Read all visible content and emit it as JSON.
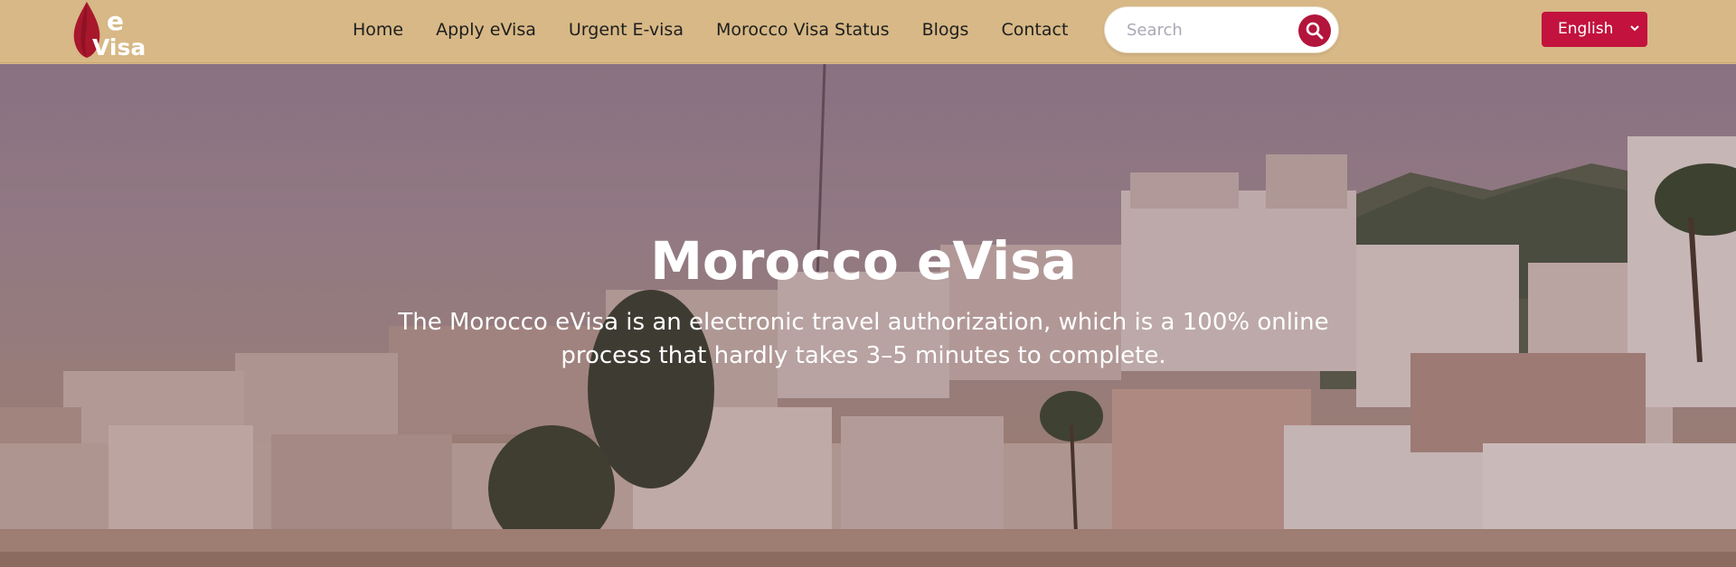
{
  "header": {
    "logo": {
      "letter": "e",
      "word": "Visa"
    },
    "nav": [
      {
        "label": "Home"
      },
      {
        "label": "Apply eVisa"
      },
      {
        "label": "Urgent E-visa"
      },
      {
        "label": "Morocco Visa Status"
      },
      {
        "label": "Blogs"
      },
      {
        "label": "Contact"
      }
    ],
    "search": {
      "placeholder": "Search",
      "value": ""
    },
    "language": {
      "selected": "English"
    }
  },
  "hero": {
    "title": "Morocco eVisa",
    "subtitle": "The Morocco eVisa is an electronic travel authorization, which is a 100% online process that hardly takes 3–5 minutes to complete."
  },
  "colors": {
    "header_bg": "#d7b886",
    "accent": "#c2123d",
    "nav_text": "#1e1e1e",
    "hero_text": "#ffffff"
  },
  "icons": {
    "logo": "red-drop-logo-icon",
    "search": "search-icon",
    "language_caret": "chevron-down-icon"
  }
}
